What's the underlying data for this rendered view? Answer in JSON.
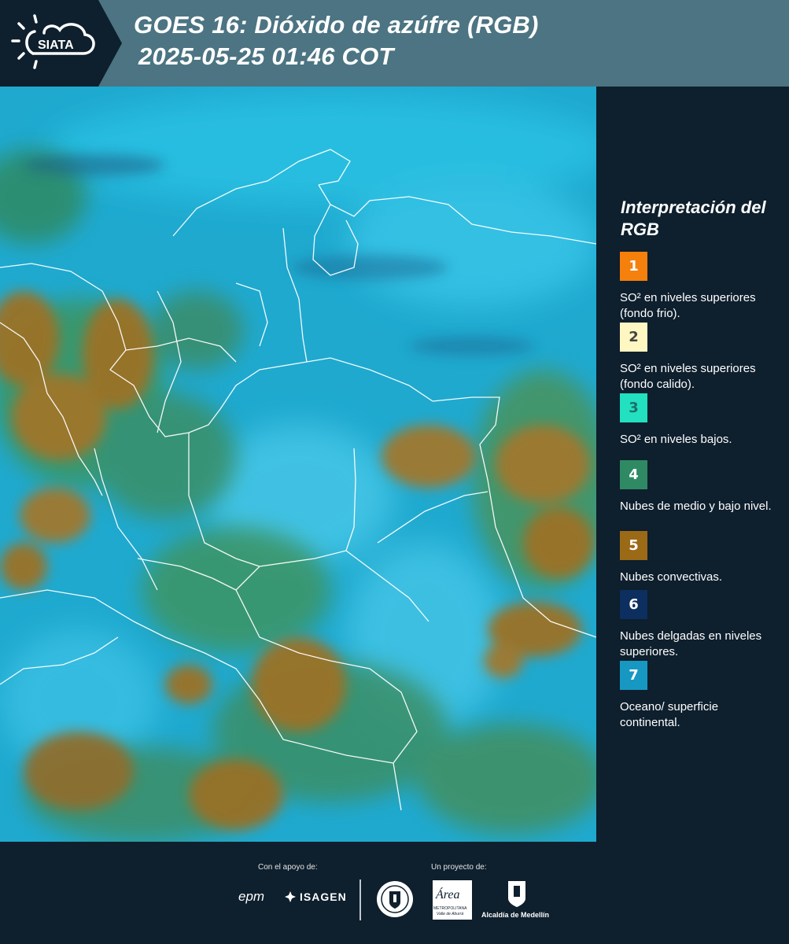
{
  "header": {
    "logo_text": "SIATA",
    "title_line1": "GOES 16: Dióxido de azúfre (RGB)",
    "title_line2": "2025-05-25 01:46 COT"
  },
  "legend": {
    "title": "Interpretación del RGB",
    "items": [
      {
        "number": "1",
        "label": "SO² en niveles superiores (fondo frio).",
        "color": "#f5800c",
        "text_color": "#ffffff"
      },
      {
        "number": "2",
        "label": "SO² en niveles superiores (fondo calido).",
        "color": "#fff7c2",
        "text_color": "#444444"
      },
      {
        "number": "3",
        "label": "SO² en niveles bajos.",
        "color": "#22e0c0",
        "text_color": "#1f6f6a"
      },
      {
        "number": "4",
        "label": "Nubes de medio y bajo nivel.",
        "color": "#2f8a64",
        "text_color": "#ffffff"
      },
      {
        "number": "5",
        "label": "Nubes convectivas.",
        "color": "#9b6a17",
        "text_color": "#ffffff"
      },
      {
        "number": "6",
        "label": "Nubes delgadas en niveles superiores.",
        "color": "#0c2f60",
        "text_color": "#ffffff"
      },
      {
        "number": "7",
        "label": "Oceano/ superficie continental.",
        "color": "#1798c2",
        "text_color": "#ffffff"
      }
    ]
  },
  "footer": {
    "support_caption": "Con el apoyo de:",
    "project_caption": "Un proyecto de:",
    "logos": {
      "epm": "epm",
      "isagen": "ISAGEN",
      "area_title": "Área",
      "area_sub": "METROPOLITANA",
      "area_sub2": "Valle de Aburrá",
      "alcaldia": "Alcaldía de Medellín"
    }
  },
  "colors": {
    "header_bg": "#4c7482",
    "panel_bg": "#0e1f2d",
    "ocean": "#1fa9cf",
    "convective": "#9b7228",
    "low_clouds": "#2f8a64"
  }
}
